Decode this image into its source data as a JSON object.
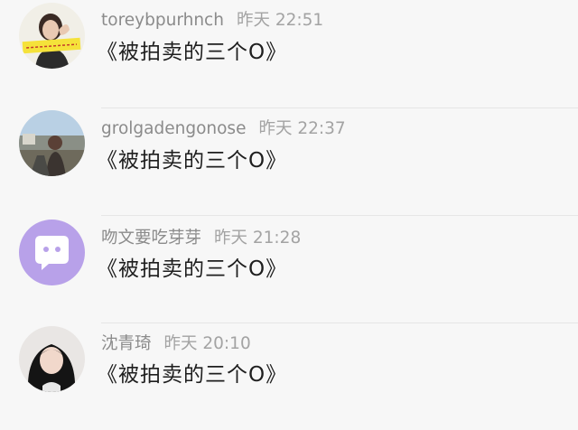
{
  "comments": [
    {
      "username": "toreybpurhnch",
      "time": "昨天 22:51",
      "text": "《被拍卖的三个O》"
    },
    {
      "username": "grolgadengonose",
      "time": "昨天 22:37",
      "text": "《被拍卖的三个O》"
    },
    {
      "username": "吻文要吃芽芽",
      "time": "昨天 21:28",
      "text": "《被拍卖的三个O》"
    },
    {
      "username": "沈青琦",
      "time": "昨天 20:10",
      "text": "《被拍卖的三个O》"
    }
  ],
  "colors": {
    "background": "#f7f7f7",
    "username": "#8b8b8b",
    "body_text": "#1e1e1e",
    "avatar3_bg": "#b8a1e9"
  }
}
